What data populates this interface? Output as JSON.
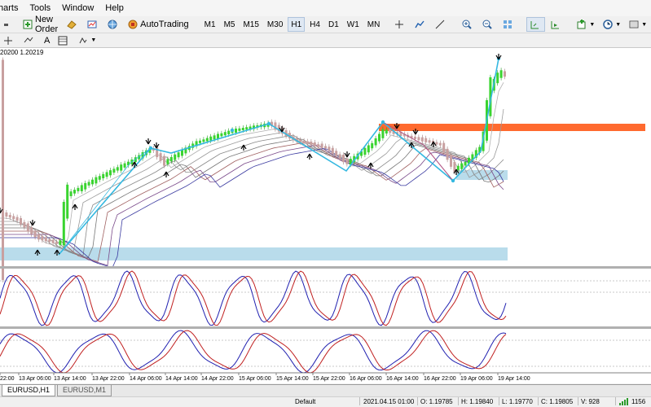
{
  "menu": [
    "harts",
    "Tools",
    "Window",
    "Help"
  ],
  "toolbar": {
    "new_order": "New Order",
    "autotrading": "AutoTrading",
    "timeframes": [
      "M1",
      "M5",
      "M15",
      "M30",
      "H1",
      "H4",
      "D1",
      "W1",
      "MN"
    ],
    "active_timeframe": "H1",
    "icons": [
      "new-order-icon",
      "expert-icon",
      "globe-icon",
      "autotrading-icon",
      "crosshair-icon",
      "hline-icon",
      "trendline-icon",
      "zoom-in-icon",
      "zoom-out-icon",
      "tile-icon",
      "chart-shift-icon",
      "autoscroll-icon",
      "indicators-icon",
      "period-clock-icon",
      "templates-icon"
    ]
  },
  "toolbar2": {
    "text_tool": "A",
    "icons": [
      "cursor-icon",
      "cross-icon",
      "line-tools-icon",
      "text-label-icon",
      "fibo-icon",
      "shapes-icon"
    ]
  },
  "hud_text": "20200 1.20219",
  "x_labels": [
    "22:00",
    "13 Apr 06:00",
    "13 Apr 14:00",
    "13 Apr 22:00",
    "14 Apr 06:00",
    "14 Apr 14:00",
    "14 Apr 22:00",
    "15 Apr 06:00",
    "15 Apr 14:00",
    "15 Apr 22:00",
    "16 Apr 06:00",
    "16 Apr 14:00",
    "16 Apr 22:00",
    "19 Apr 06:00",
    "19 Apr 14:00"
  ],
  "tabs": [
    "EURUSD,H1",
    "EURUSD,M1"
  ],
  "active_tab": "EURUSD,H1",
  "status": {
    "profile": "Default",
    "datetime": "2021.04.15 01:00",
    "open": "O: 1.19785",
    "high": "H: 1.19840",
    "low": "L: 1.19770",
    "close": "C: 1.19805",
    "volume": "V: 928",
    "traffic": "1156"
  },
  "colors": {
    "bull_candle": "#39d42f",
    "bear_candle": "#c8a0a0",
    "zigzag": "#34b8e0",
    "resistance_zone": "#ff6a2f",
    "support_zone": "#b9dceb",
    "stoch_main": "#2020b0",
    "stoch_signal": "#c02020"
  }
}
